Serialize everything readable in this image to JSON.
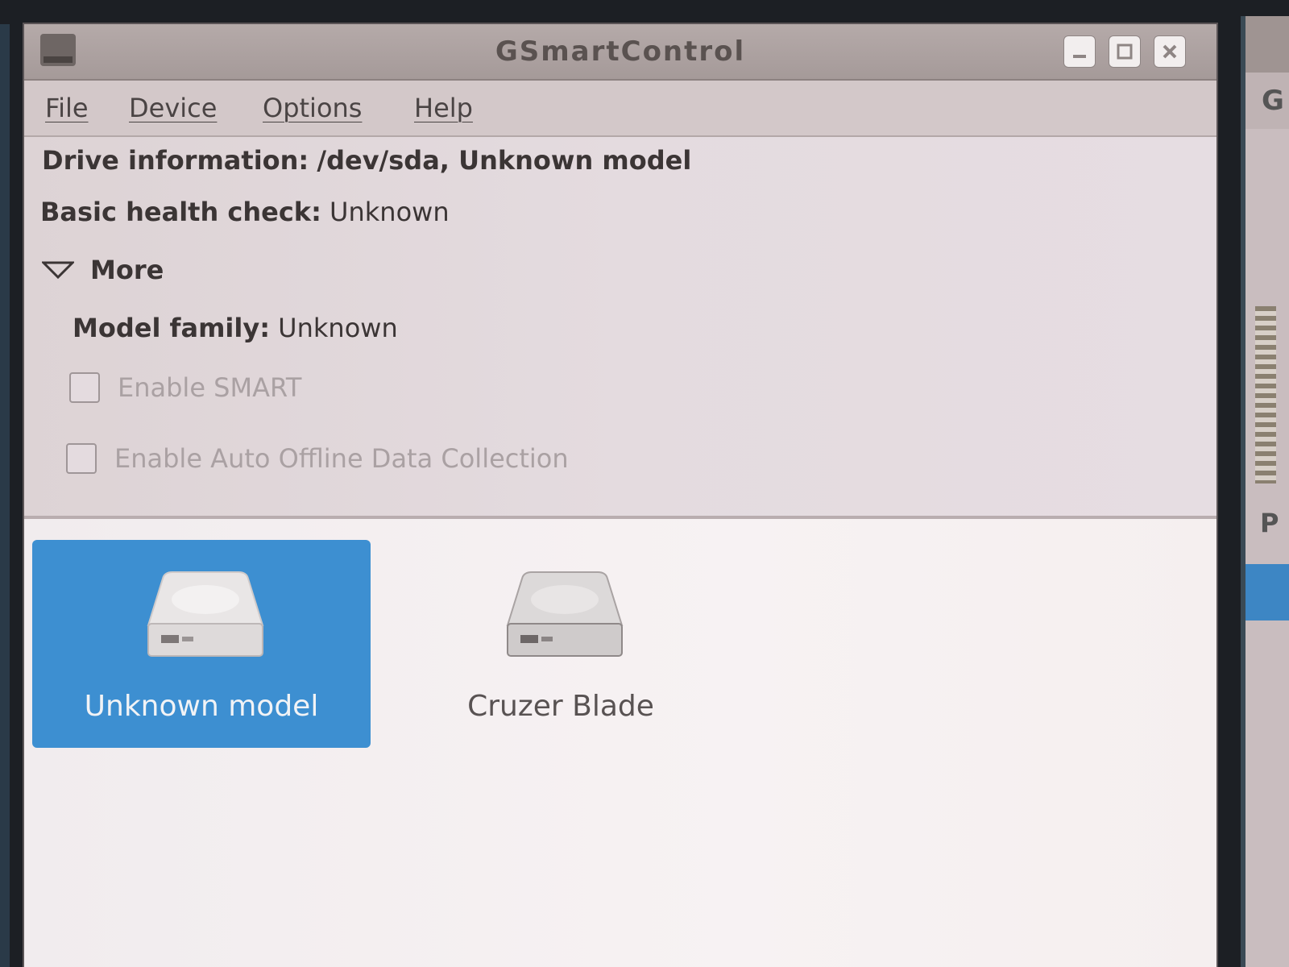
{
  "window": {
    "title": "GSmartControl"
  },
  "menu": {
    "file": "File",
    "device": "Device",
    "options": "Options",
    "help": "Help"
  },
  "info": {
    "drive_label": "Drive information:",
    "drive_value": "/dev/sda, Unknown model",
    "health_label": "Basic health check:",
    "health_value": "Unknown",
    "more_label": "More",
    "model_family_label": "Model family:",
    "model_family_value": "Unknown",
    "enable_smart": "Enable SMART",
    "enable_offline": "Enable Auto Offline Data Collection"
  },
  "devices": [
    {
      "label": "Unknown model",
      "selected": true
    },
    {
      "label": "Cruzer Blade",
      "selected": false
    }
  ],
  "colors": {
    "selection": "#3d8fd1",
    "window_bg": "#dcd1d3",
    "iconview_bg": "#f5efef"
  },
  "icons": {
    "app": "gsmartcontrol-icon",
    "expander": "triangle-down-icon",
    "drive": "hard-drive-icon"
  }
}
